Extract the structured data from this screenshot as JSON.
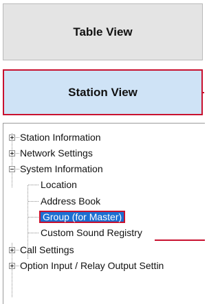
{
  "views": {
    "table_view_label": "Table View",
    "station_view_label": "Station View"
  },
  "tree": {
    "items": [
      {
        "label": "Station Information",
        "expander": "plus"
      },
      {
        "label": "Network Settings",
        "expander": "plus"
      },
      {
        "label": "System Information",
        "expander": "minus"
      },
      {
        "label": "Location"
      },
      {
        "label": "Address Book"
      },
      {
        "label": "Group (for Master)",
        "selected": true
      },
      {
        "label": "Custom Sound Registry"
      },
      {
        "label": "Call Settings",
        "expander": "plus"
      },
      {
        "label": "Option Input / Relay Output Settin",
        "expander": "plus"
      }
    ]
  },
  "colors": {
    "highlight": "#c8102e",
    "selection": "#1c6fd2",
    "station_view_bg": "#cfe3f6"
  }
}
